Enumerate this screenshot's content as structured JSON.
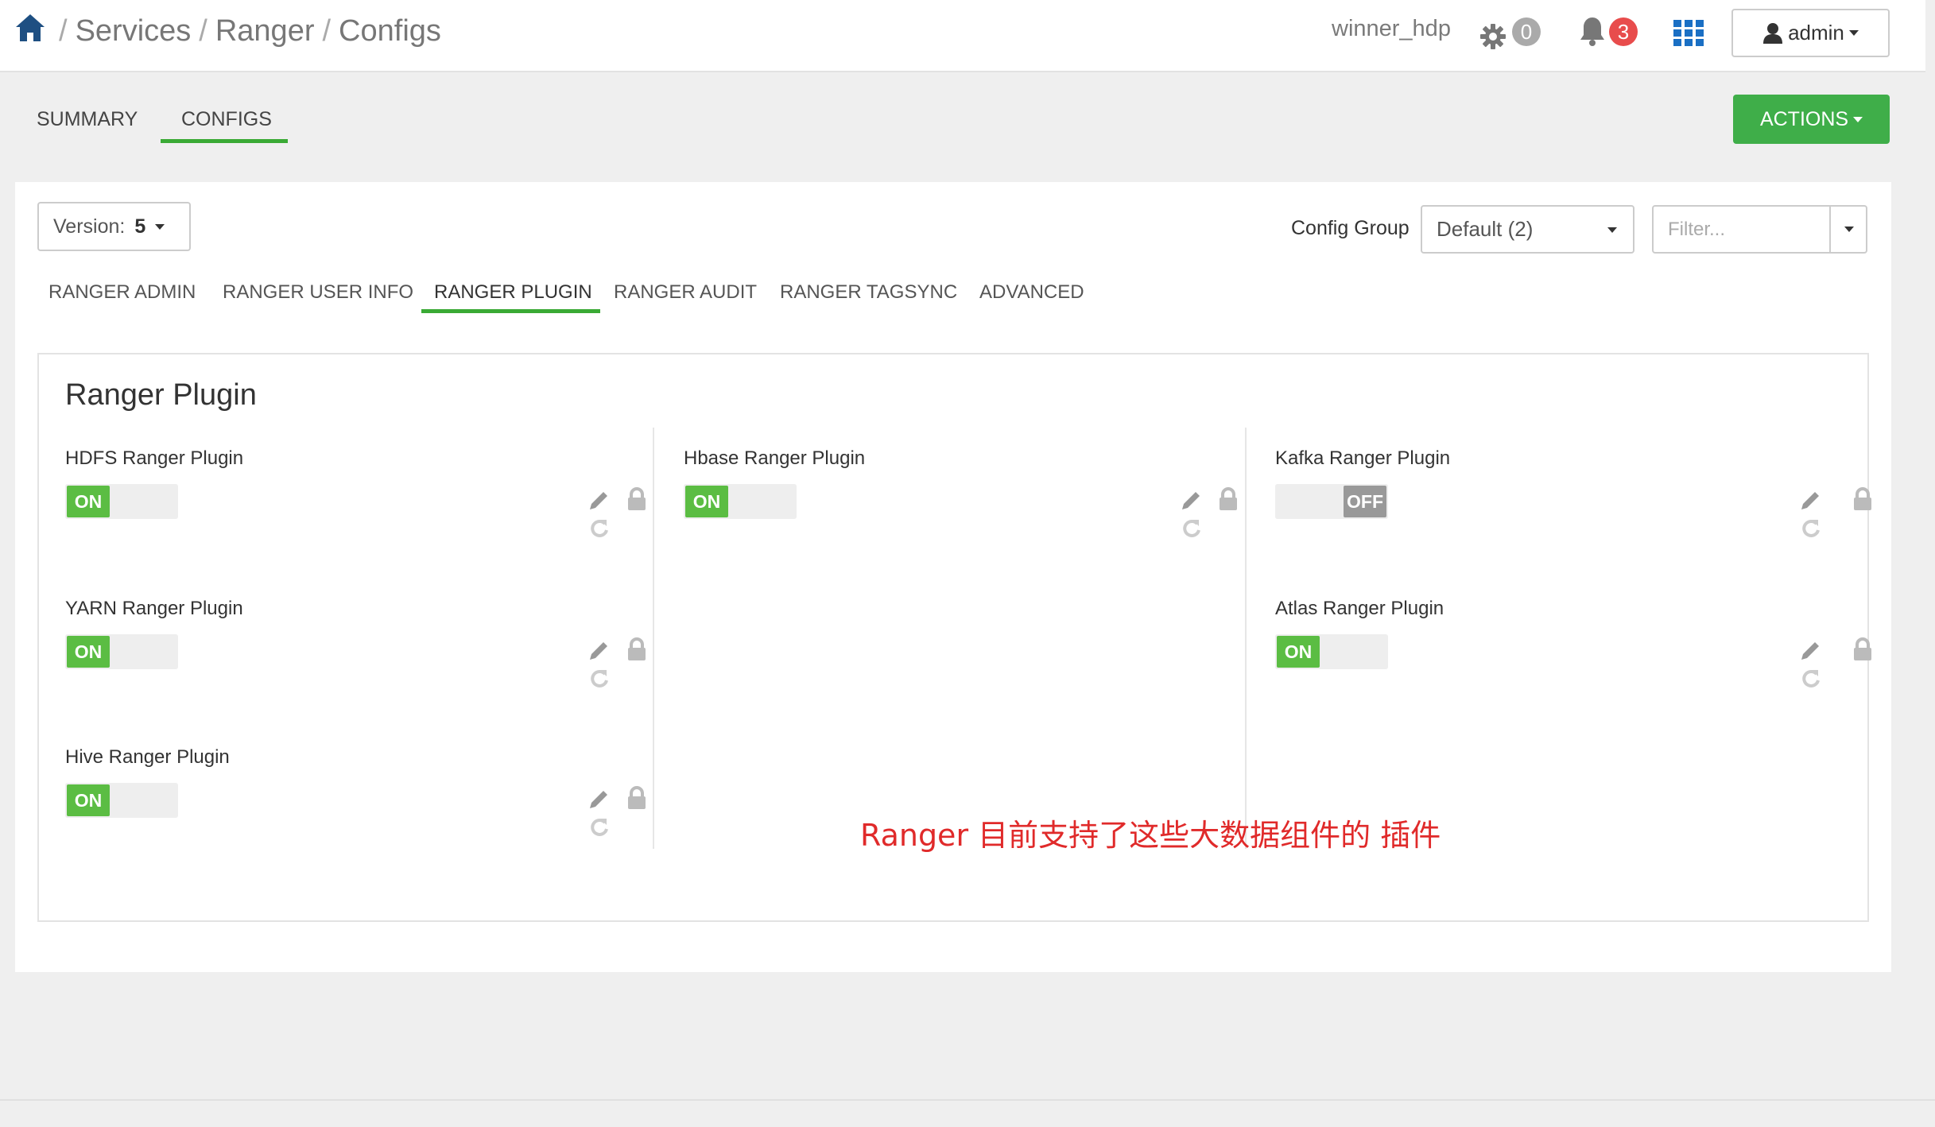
{
  "header": {
    "breadcrumb": [
      "Services",
      "Ranger",
      "Configs"
    ],
    "breadcrumb_sep": "/",
    "cluster_name": "winner_hdp",
    "ops_count": "0",
    "alerts_count": "3",
    "user_label": "admin"
  },
  "main_tabs": [
    {
      "label": "SUMMARY",
      "active": false
    },
    {
      "label": "CONFIGS",
      "active": true
    }
  ],
  "actions_label": "ACTIONS",
  "version": {
    "label": "Version:",
    "value": "5"
  },
  "config_group": {
    "label": "Config Group",
    "selected": "Default (2)"
  },
  "filter": {
    "placeholder": "Filter..."
  },
  "sub_tabs": [
    {
      "label": "RANGER ADMIN",
      "active": false
    },
    {
      "label": "RANGER USER INFO",
      "active": false
    },
    {
      "label": "RANGER PLUGIN",
      "active": true
    },
    {
      "label": "RANGER AUDIT",
      "active": false
    },
    {
      "label": "RANGER TAGSYNC",
      "active": false
    },
    {
      "label": "ADVANCED",
      "active": false
    }
  ],
  "section": {
    "title": "Ranger Plugin",
    "plugins": [
      {
        "label": "HDFS Ranger Plugin",
        "state": "ON"
      },
      {
        "label": "YARN Ranger Plugin",
        "state": "ON"
      },
      {
        "label": "Hive Ranger Plugin",
        "state": "ON"
      },
      {
        "label": "Hbase Ranger Plugin",
        "state": "ON"
      },
      {
        "label": "Kafka Ranger Plugin",
        "state": "OFF"
      },
      {
        "label": "Atlas Ranger Plugin",
        "state": "ON"
      }
    ]
  },
  "annotation": "Ranger 目前支持了这些大数据组件的 插件",
  "colors": {
    "accent_green": "#3fae49",
    "toggle_on": "#5bbd43",
    "toggle_off": "#999999",
    "alert_red": "#e84c4c",
    "ops_grey": "#aaaaaa",
    "annotation_red": "#e02a2a",
    "brand_blue": "#1a6fc4"
  },
  "icons": [
    "home-icon",
    "gear-icon",
    "bell-icon",
    "grid-icon",
    "user-icon",
    "caret-down-icon",
    "pencil-icon",
    "undo-icon",
    "lock-icon"
  ]
}
